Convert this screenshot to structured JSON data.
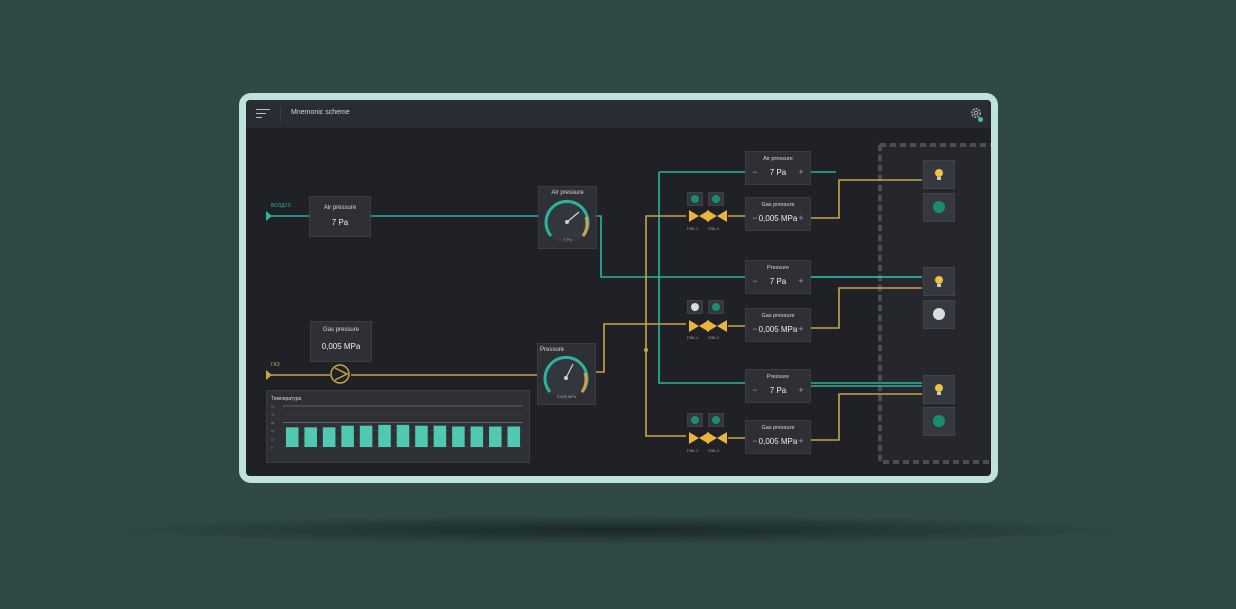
{
  "app": {
    "title": "Mnemonic scheme"
  },
  "inputs": {
    "air_label": "ВОЗДУХ",
    "gas_label": "ГАЗ"
  },
  "panels": {
    "air_pressure": {
      "label": "Air pressure",
      "value": "7 Pa"
    },
    "gas_pressure": {
      "label": "Gas pressure",
      "value": "0,005 MPa"
    }
  },
  "gauges": {
    "air": {
      "label": "Air pressure",
      "unit_text": "7 Pa",
      "level": 0.7
    },
    "gas": {
      "label": "Pressure",
      "unit_text": "0,005 MPa",
      "level": 0.55
    }
  },
  "steppers": [
    {
      "label": "Air pressure",
      "value": "7 Pa"
    },
    {
      "label": "Gas pressure",
      "value": "0,005 MPa"
    },
    {
      "label": "Pressure",
      "value": "7 Pa"
    },
    {
      "label": "Gas pressure",
      "value": "0,005 MPa"
    },
    {
      "label": "Pressure",
      "value": "7 Pa"
    },
    {
      "label": "Gas pressure",
      "value": "0,005 MPa"
    }
  ],
  "valves": [
    "ПЗК-1",
    "ПЗК-2"
  ],
  "chart_data": {
    "type": "bar",
    "title": "Температура",
    "categories": [
      "",
      "",
      "",
      "",
      "",
      "",
      "",
      "",
      "",
      "",
      "",
      "",
      ""
    ],
    "values": [
      24,
      24,
      24,
      26,
      26,
      27,
      27,
      26,
      26,
      25,
      25,
      25,
      25
    ],
    "ylim": [
      0,
      50
    ],
    "yticks": [
      "50",
      "40",
      "30",
      "20",
      "10",
      "0"
    ],
    "grid": true,
    "color": "#4fc9b1"
  },
  "colors": {
    "teal": "#2bb3a0",
    "gold": "#c9a44a",
    "lamp_yellow": "#f0c23c",
    "lamp_teal": "#1b8c74",
    "lamp_white": "#d9dde0"
  }
}
